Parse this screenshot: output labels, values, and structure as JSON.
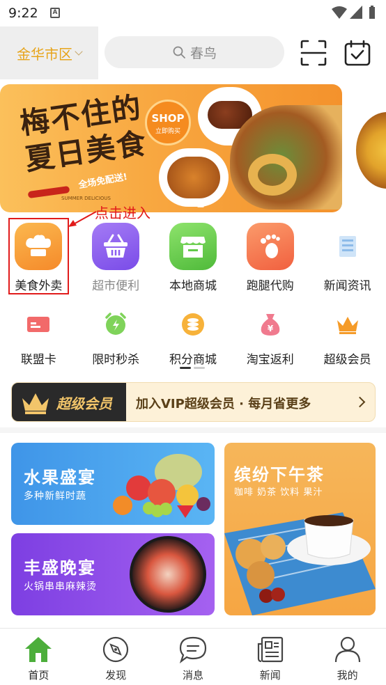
{
  "status_bar": {
    "time": "9:22",
    "notification_glyph": "A"
  },
  "header": {
    "city": "金华市区",
    "search_placeholder": "春鸟",
    "scan_icon": "scan-icon",
    "calendar_icon": "calendar-check-icon"
  },
  "banner": {
    "headline": "梅不住的夏日美食",
    "summer_text": "SUMMER DELICIOUS",
    "badge_top": "SHOP",
    "badge_bottom": "立即购买",
    "free_shipping": "全场免配送!"
  },
  "annotation": {
    "text": "点击进入",
    "color": "#e11b1b"
  },
  "categories_row1": [
    {
      "label": "美食外卖",
      "icon": "chef-hat-icon",
      "color": "#f6a03a"
    },
    {
      "label": "超市便利",
      "icon": "basket-icon",
      "color": "#8b5cf0"
    },
    {
      "label": "本地商城",
      "icon": "store-icon",
      "color": "#63c94a"
    },
    {
      "label": "跑腿代购",
      "icon": "footprint-icon",
      "color": "#f4764e"
    },
    {
      "label": "新闻资讯",
      "icon": "news-icon",
      "color": "#a9cdef"
    }
  ],
  "categories_row2": [
    {
      "label": "联盟卡",
      "icon": "card-icon",
      "color": "#f26a6a"
    },
    {
      "label": "限时秒杀",
      "icon": "alarm-clock-icon",
      "color": "#7fd35a"
    },
    {
      "label": "积分商城",
      "icon": "coins-icon",
      "color": "#f7b23a"
    },
    {
      "label": "淘宝返利",
      "icon": "money-bag-icon",
      "color": "#f07a8e"
    },
    {
      "label": "超级会员",
      "icon": "crown-icon",
      "color": "#f59b28"
    }
  ],
  "vip_bar": {
    "title": "超级会员",
    "text": "加入VIP超级会员 · 每月省更多"
  },
  "cards": {
    "fruit": {
      "title": "水果盛宴",
      "subtitle": "多种新鲜时蔬"
    },
    "dinner": {
      "title": "丰盛晚宴",
      "subtitle": "火锅串串麻辣烫"
    },
    "tea": {
      "title": "缤纷下午茶",
      "subtitle": "咖啡 奶茶 饮料 果汁"
    }
  },
  "tabbar": [
    {
      "label": "首页",
      "icon": "home-icon",
      "active": true
    },
    {
      "label": "发现",
      "icon": "compass-icon",
      "active": false
    },
    {
      "label": "消息",
      "icon": "message-icon",
      "active": false
    },
    {
      "label": "新闻",
      "icon": "newspaper-icon",
      "active": false
    },
    {
      "label": "我的",
      "icon": "person-icon",
      "active": false
    }
  ],
  "colors": {
    "accent_orange": "#f6a03a",
    "home_green": "#4cae3b",
    "city_text": "#e7a41a"
  }
}
